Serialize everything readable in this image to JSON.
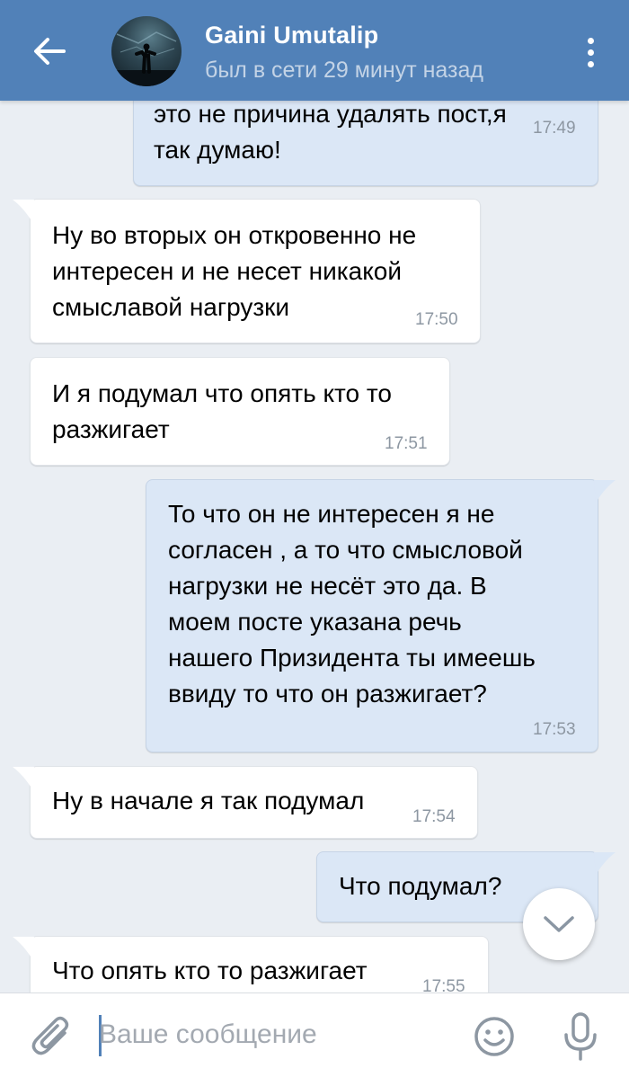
{
  "header": {
    "contact_name": "Gaini Umutalip",
    "status": "был в сети 29 минут назад",
    "back_icon": "arrow-left-icon",
    "menu_icon": "more-vertical-icon"
  },
  "messages": [
    {
      "direction": "out",
      "lines": [
        "это не причина удалять пост,я",
        "так думаю!"
      ],
      "time": "17:49"
    },
    {
      "direction": "in",
      "lines": [
        "Ну во вторых он откровенно не",
        "интересен и не несет никакой",
        "смыславой нагрузки"
      ],
      "time": "17:50"
    },
    {
      "direction": "in",
      "lines": [
        "И я подумал что опять кто то",
        "разжигает"
      ],
      "time": "17:51"
    },
    {
      "direction": "out",
      "lines": [
        "То что он не интересен я не",
        "согласен , а то что смысловой",
        "нагрузки не несёт это да. В",
        "моем посте указана речь",
        "нашего Призидента ты имеешь",
        "ввиду то что он разжигает?"
      ],
      "time": "17:53"
    },
    {
      "direction": "in",
      "lines": [
        "Ну в начале я так подумал"
      ],
      "time": "17:54"
    },
    {
      "direction": "out",
      "lines": [
        "Что подумал?"
      ],
      "time": ""
    },
    {
      "direction": "in",
      "lines": [
        "Что опять кто то разжигает"
      ],
      "time": "17:55"
    }
  ],
  "composer": {
    "placeholder": "Ваше сообщение",
    "value": ""
  },
  "colors": {
    "header_bg": "#5181b8",
    "chat_bg": "#eaeef3",
    "incoming_bubble": "#ffffff",
    "outgoing_bubble": "#dbe7f6"
  }
}
